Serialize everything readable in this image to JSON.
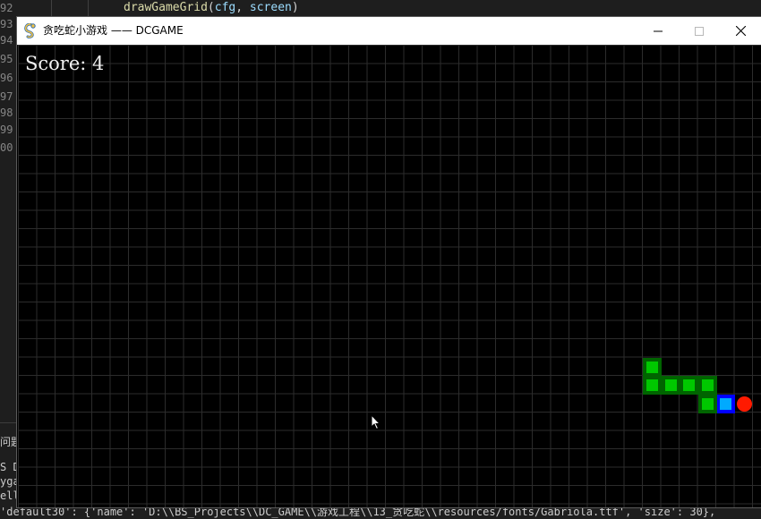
{
  "editor": {
    "line_numbers": [
      "92",
      "93",
      "94",
      "95",
      "96",
      "97",
      "98",
      "99",
      "00"
    ],
    "code_line": {
      "fn": "drawGameGrid",
      "open": "(",
      "arg1": "cfg",
      "sep": ", ",
      "arg2": "screen",
      "close": ")"
    },
    "panel_lines": [
      "问题",
      "S D",
      "yga",
      "ell",
      "'default30': {'name': 'D:\\\\BS_Projects\\\\DC_GAME\\\\游戏工程\\\\13_贪吃蛇\\\\resources/fonts/Gabriola.ttf', 'size': 30},"
    ]
  },
  "window": {
    "title": "贪吃蛇小游戏 —— DCGAME",
    "icon": "pygame-snake-icon",
    "controls": [
      "minimize-icon",
      "maximize-icon",
      "close-icon"
    ]
  },
  "game": {
    "score_label": "Score: 4",
    "score": 4,
    "grid_color": "#2c2c2c",
    "background_color": "#000000",
    "snake_body_color": "#00c800",
    "snake_body_border_color": "#006400",
    "snake_head_color": "#00aaff",
    "snake_head_border_color": "#0000ff",
    "food_color": "#ff1a00",
    "grid_cols": 40,
    "snake": [
      {
        "col": 38,
        "row": 19,
        "part": "head"
      },
      {
        "col": 37,
        "row": 19,
        "part": "body"
      },
      {
        "col": 37,
        "row": 18,
        "part": "body"
      },
      {
        "col": 36,
        "row": 18,
        "part": "body"
      },
      {
        "col": 35,
        "row": 18,
        "part": "body"
      },
      {
        "col": 34,
        "row": 18,
        "part": "body"
      },
      {
        "col": 34,
        "row": 17,
        "part": "body"
      }
    ],
    "food": {
      "col": 39,
      "row": 19
    }
  }
}
